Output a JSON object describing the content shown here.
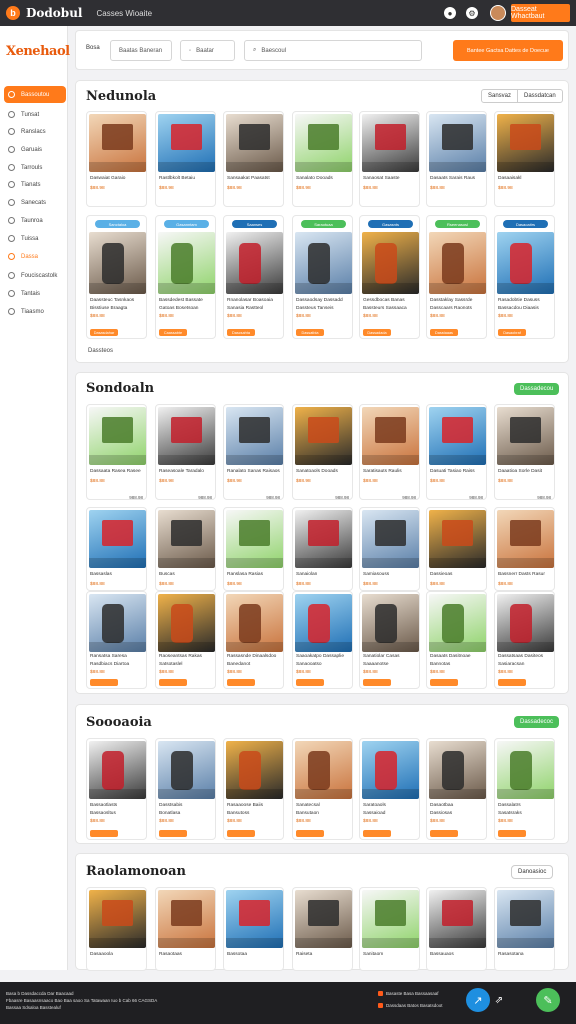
{
  "topbar": {
    "brand_icon": "b",
    "brand": "Dodobul",
    "subtitle": "Casses Wioaite",
    "cta": "Dasseat Whactbaut"
  },
  "sidebar": {
    "logo": "Xenehaol",
    "items": [
      {
        "label": "Bassoutou",
        "active": true
      },
      {
        "label": "Tunsat"
      },
      {
        "label": "Ranslacs"
      },
      {
        "label": "Garuais"
      },
      {
        "label": "Tarrouls"
      },
      {
        "label": "Tianats"
      },
      {
        "label": "Sanecats"
      },
      {
        "label": "Taunroa"
      },
      {
        "label": "Tuissa"
      },
      {
        "label": "Dassa",
        "orange": true
      },
      {
        "label": "Fouciscastolk"
      },
      {
        "label": "Tantais"
      },
      {
        "label": "Tiaasmo"
      }
    ]
  },
  "header": {
    "label": "Bosa",
    "field1": "Baatas   Baneran",
    "field2": "Baatar",
    "search_placeholder": "Baescoul",
    "button": "Bantee Gactsa Dattes de Doecue"
  },
  "sections": {
    "s1": {
      "title": "Nedunola",
      "tab1": "Sansvaz",
      "tab2": "Dassdatcan",
      "footer": "Dassteos"
    },
    "s2": {
      "title": "Sondoaln",
      "button": "Dassadecou"
    },
    "s3": {
      "title": "Soooaoia",
      "button": "Dassadecoc"
    },
    "s4": {
      "title": "Raolamonoan",
      "button": "Danoasioc"
    }
  },
  "cards": {
    "r1": [
      {
        "t": "Daswaiat Garaio",
        "p": "$88.98"
      },
      {
        "t": "Rastlbkolt Betaiu",
        "p": "$88.98"
      },
      {
        "t": "Sansaakat Paasatst",
        "p": "$88.98"
      },
      {
        "t": "Sanalato Dooads",
        "p": "$88.98"
      },
      {
        "t": "Sanaosat Saaste",
        "p": "$88.88"
      },
      {
        "t": "Dasaats Sarais Raus",
        "p": "$88.88"
      },
      {
        "t": "Dasaaisakl",
        "p": "$88.98"
      }
    ],
    "r2": [
      {
        "pill": "Sanctaloa",
        "t": "Daassteuc Tasnkaos",
        "t2": "Bisstiuse Braagta",
        "p": "$88.88",
        "btn": "Dasasdahar"
      },
      {
        "pill": "Gasanntam",
        "t": "Bassdedest Bassate",
        "t2": "Gatoas Bosetsoan",
        "p": "$88.88",
        "btn": "Caassabte"
      },
      {
        "pill": "Saanses",
        "t": "Rnanolasar Boasoaia",
        "t2": "Sanasia Rastteol",
        "p": "$88.88",
        "btn": "Dascsahta"
      },
      {
        "pill": "Saraotuaa",
        "t": "Dassaodsay Dassadd",
        "t2": "Dassteus Tanseis",
        "p": "$88.88",
        "btn": "Dassatbia"
      },
      {
        "pill": "Gasasnts",
        "t": "Gessdbocas Banas",
        "t2": "Bassteurs Sassaaca",
        "p": "$88.88",
        "btn": "Dassadada"
      },
      {
        "pill": "Rseenasosl",
        "t": "Dasstaklay Sassrde",
        "t2": "Dasscaars Raonots",
        "p": "$88.88",
        "btn": "Dasstaaas"
      },
      {
        "pill": "Dasaoaitrs",
        "t": "Rasadobtie Dasuss",
        "t2": "Bassacdou Diaasis",
        "p": "$88.88",
        "btn": "Dasaobraf"
      }
    ],
    "g1": [
      {
        "t": "Dassaata Rasea Rasee",
        "p": "$88.88",
        "c": "988.98"
      },
      {
        "t": "Raseasoale Taradalo",
        "p": "$88.98",
        "c": "988.98"
      },
      {
        "t": "Ranalato Sanas Raisaos",
        "p": "$88.98",
        "c": "988.98"
      },
      {
        "t": "Sanatoaols Dooads",
        "p": "$88.98",
        "c": "988.98"
      },
      {
        "t": "Saratisauts Raulis",
        "p": "$88.88",
        "c": "988.98"
      },
      {
        "t": "Dasuati Tasiao Raiss",
        "p": "$88.88",
        "c": "988.98"
      },
      {
        "t": "Daaatioa Sorle Dasit",
        "p": "$88.88",
        "c": "988.98"
      }
    ],
    "g2": [
      {
        "t": "Bassaslas",
        "p": "$88.88",
        "c": "988.98"
      },
      {
        "t": "Buscas",
        "p": "$88.88",
        "c": "988.98"
      },
      {
        "t": "Ranslasa Rasias",
        "p": "$88.98",
        "c": "988.98"
      },
      {
        "t": "Sanaiolan",
        "p": "$88.88",
        "c": "988.98"
      },
      {
        "t": "Samiasouss",
        "p": "$88.88",
        "c": "988.98"
      },
      {
        "t": "Dassieoas",
        "p": "$88.88",
        "c": "988.98"
      },
      {
        "t": "Bassnerr Dasts Rasur",
        "p": "$88.88",
        "c": "988.98"
      }
    ],
    "g3": [
      {
        "t": "Ransatsa Saresa",
        "t2": "Rasdbiacs Diartoa",
        "p": "$88.88"
      },
      {
        "t": "Raoseantsas Rakas",
        "t2": "Satsotaslel",
        "p": "$88.88"
      },
      {
        "t": "Rassasnde Dinaalsdoo",
        "t2": "Banedanot",
        "p": "$88.88"
      },
      {
        "t": "Saaoakatpo Dassaplie",
        "t2": "Sanaooatso",
        "p": "$88.88"
      },
      {
        "t": "Sanatiolar Casas",
        "t2": "Saaaanotse",
        "p": "$88.88"
      },
      {
        "t": "Dasaats Dasitnoae",
        "t2": "Bannotas",
        "p": "$88.88"
      },
      {
        "t": "Dassatsaas Dasiteos",
        "t2": "Sasiaracsan",
        "p": "$88.88"
      }
    ],
    "r3": [
      {
        "t": "Bassaotlasts",
        "t2": "Bassaosltus",
        "p": "$88.88"
      },
      {
        "t": "Dasstsabis",
        "t2": "Bonatlasa",
        "p": "$88.88"
      },
      {
        "t": "Rasaaoose Baiis",
        "t2": "Bansutoss",
        "p": "$88.88"
      },
      {
        "t": "Sanatecsal",
        "t2": "Bansutaon",
        "p": "$88.88"
      },
      {
        "t": "Saratoaols",
        "t2": "Sassaioad",
        "p": "$88.88"
      },
      {
        "t": "Dasaotbaa",
        "t2": "Dassiosas",
        "p": "$88.88"
      },
      {
        "t": "Dassalatrs",
        "t2": "Sasatsraks",
        "p": "$88.88"
      }
    ],
    "r4": [
      {
        "t": "Dasaaoola"
      },
      {
        "t": "Rasaotaas"
      },
      {
        "t": "Bassotaa"
      },
      {
        "t": "Raiseta"
      },
      {
        "t": "Sanitaom"
      },
      {
        "t": "Bassauaos"
      },
      {
        "t": "Rasasotana"
      }
    ]
  },
  "footer": {
    "line1": "Basa b  Dassdaccda Dar Baacaad",
    "line2": "Fbaasre Basaasnsaaco Bao Baa saoo Sa Tatawaan Iuo b Cab 66 CAGSDA",
    "line3": "Bassaa Sdsaloa  Basstealuf",
    "right1": "Basaste Basa Bassaasaaf",
    "right2": "Dassdaas Batos Basatsdoot",
    "fab_blue": "↗",
    "fab_share": "⇗",
    "fab_green": "✎"
  }
}
